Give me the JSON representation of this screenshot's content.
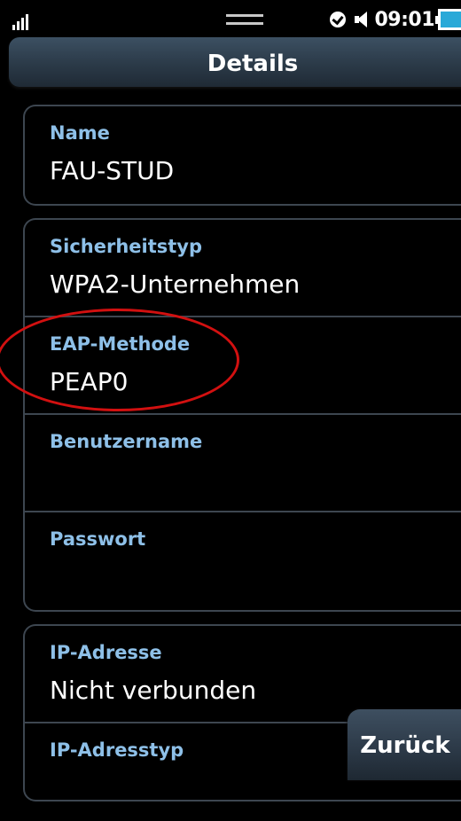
{
  "status_bar": {
    "time": "09:01",
    "icons": [
      "signal-icon",
      "handle-icon",
      "alarm-icon",
      "speaker-icon",
      "battery-icon"
    ]
  },
  "header": {
    "title": "Details"
  },
  "network": {
    "name_label": "Name",
    "name_value": "FAU-STUD"
  },
  "security": {
    "rows": [
      {
        "label": "Sicherheitstyp",
        "value": "WPA2-Unternehmen"
      },
      {
        "label": "EAP-Methode",
        "value": "PEAP0"
      },
      {
        "label": "Benutzername",
        "value": ""
      },
      {
        "label": "Passwort",
        "value": ""
      }
    ]
  },
  "ip": {
    "rows": [
      {
        "label": "IP-Adresse",
        "value": "Nicht verbunden"
      },
      {
        "label": "IP-Adresstyp",
        "value": ""
      }
    ]
  },
  "buttons": {
    "back_label": "Zurück"
  },
  "colors": {
    "label": "#8ec0e8",
    "header": "#2b3a48",
    "card_border": "#3d4650",
    "annotation": "#d21010"
  }
}
